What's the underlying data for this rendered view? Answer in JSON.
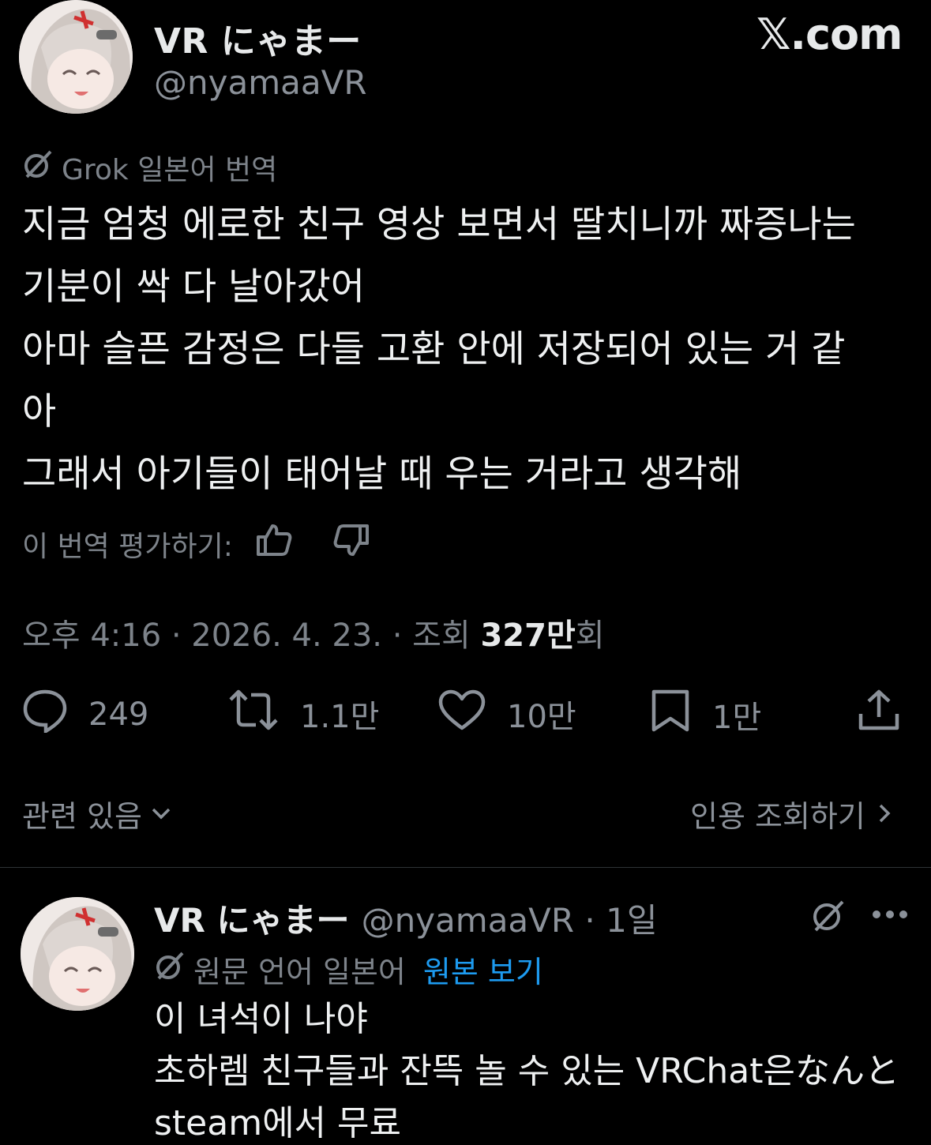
{
  "brand": "𝕏.com",
  "tweet": {
    "display_name": "VR にゃまー",
    "handle": "@nyamaaVR",
    "translation_label": "Grok 일본어 번역",
    "body_lines": [
      "지금 엄청 에로한 친구 영상 보면서 딸치니까 짜증나는",
      "기분이 싹 다 날아갔어",
      "아마 슬픈 감정은 다들 고환 안에 저장되어 있는 거 같",
      "아",
      "그래서 아기들이 태어날 때 우는 거라고 생각해"
    ],
    "rate_label": "이 번역 평가하기:",
    "meta": {
      "time_date": "오후 4:16 · 2026. 4. 23. · 조회 ",
      "views_number": "327만",
      "views_suffix": "회"
    },
    "actions": {
      "replies": "249",
      "retweets": "1.1만",
      "likes": "10만",
      "bookmarks": "1만"
    },
    "related_label": "관련 있음",
    "quote_label": "인용 조회하기"
  },
  "reply": {
    "display_name": "VR にゃまー",
    "handle_time": "@nyamaaVR · 1일",
    "lang_label": "원문 언어 일본어",
    "view_original": "원본 보기",
    "lines": [
      "이 녀석이 나야",
      "초하렘 친구들과 잔뜩 놀 수 있는 VRChat은なんと",
      "steam에서 무료"
    ]
  },
  "colors": {
    "background": "#000000",
    "text": "#e7e9ea",
    "muted": "#7d838a",
    "link": "#1d9bf0"
  },
  "icons": [
    "translate-icon",
    "thumbs-up-icon",
    "thumbs-down-icon",
    "reply-icon",
    "retweet-icon",
    "like-icon",
    "bookmark-icon",
    "share-icon",
    "chevron-down-icon",
    "chevron-right-icon",
    "grok-icon",
    "more-icon"
  ]
}
